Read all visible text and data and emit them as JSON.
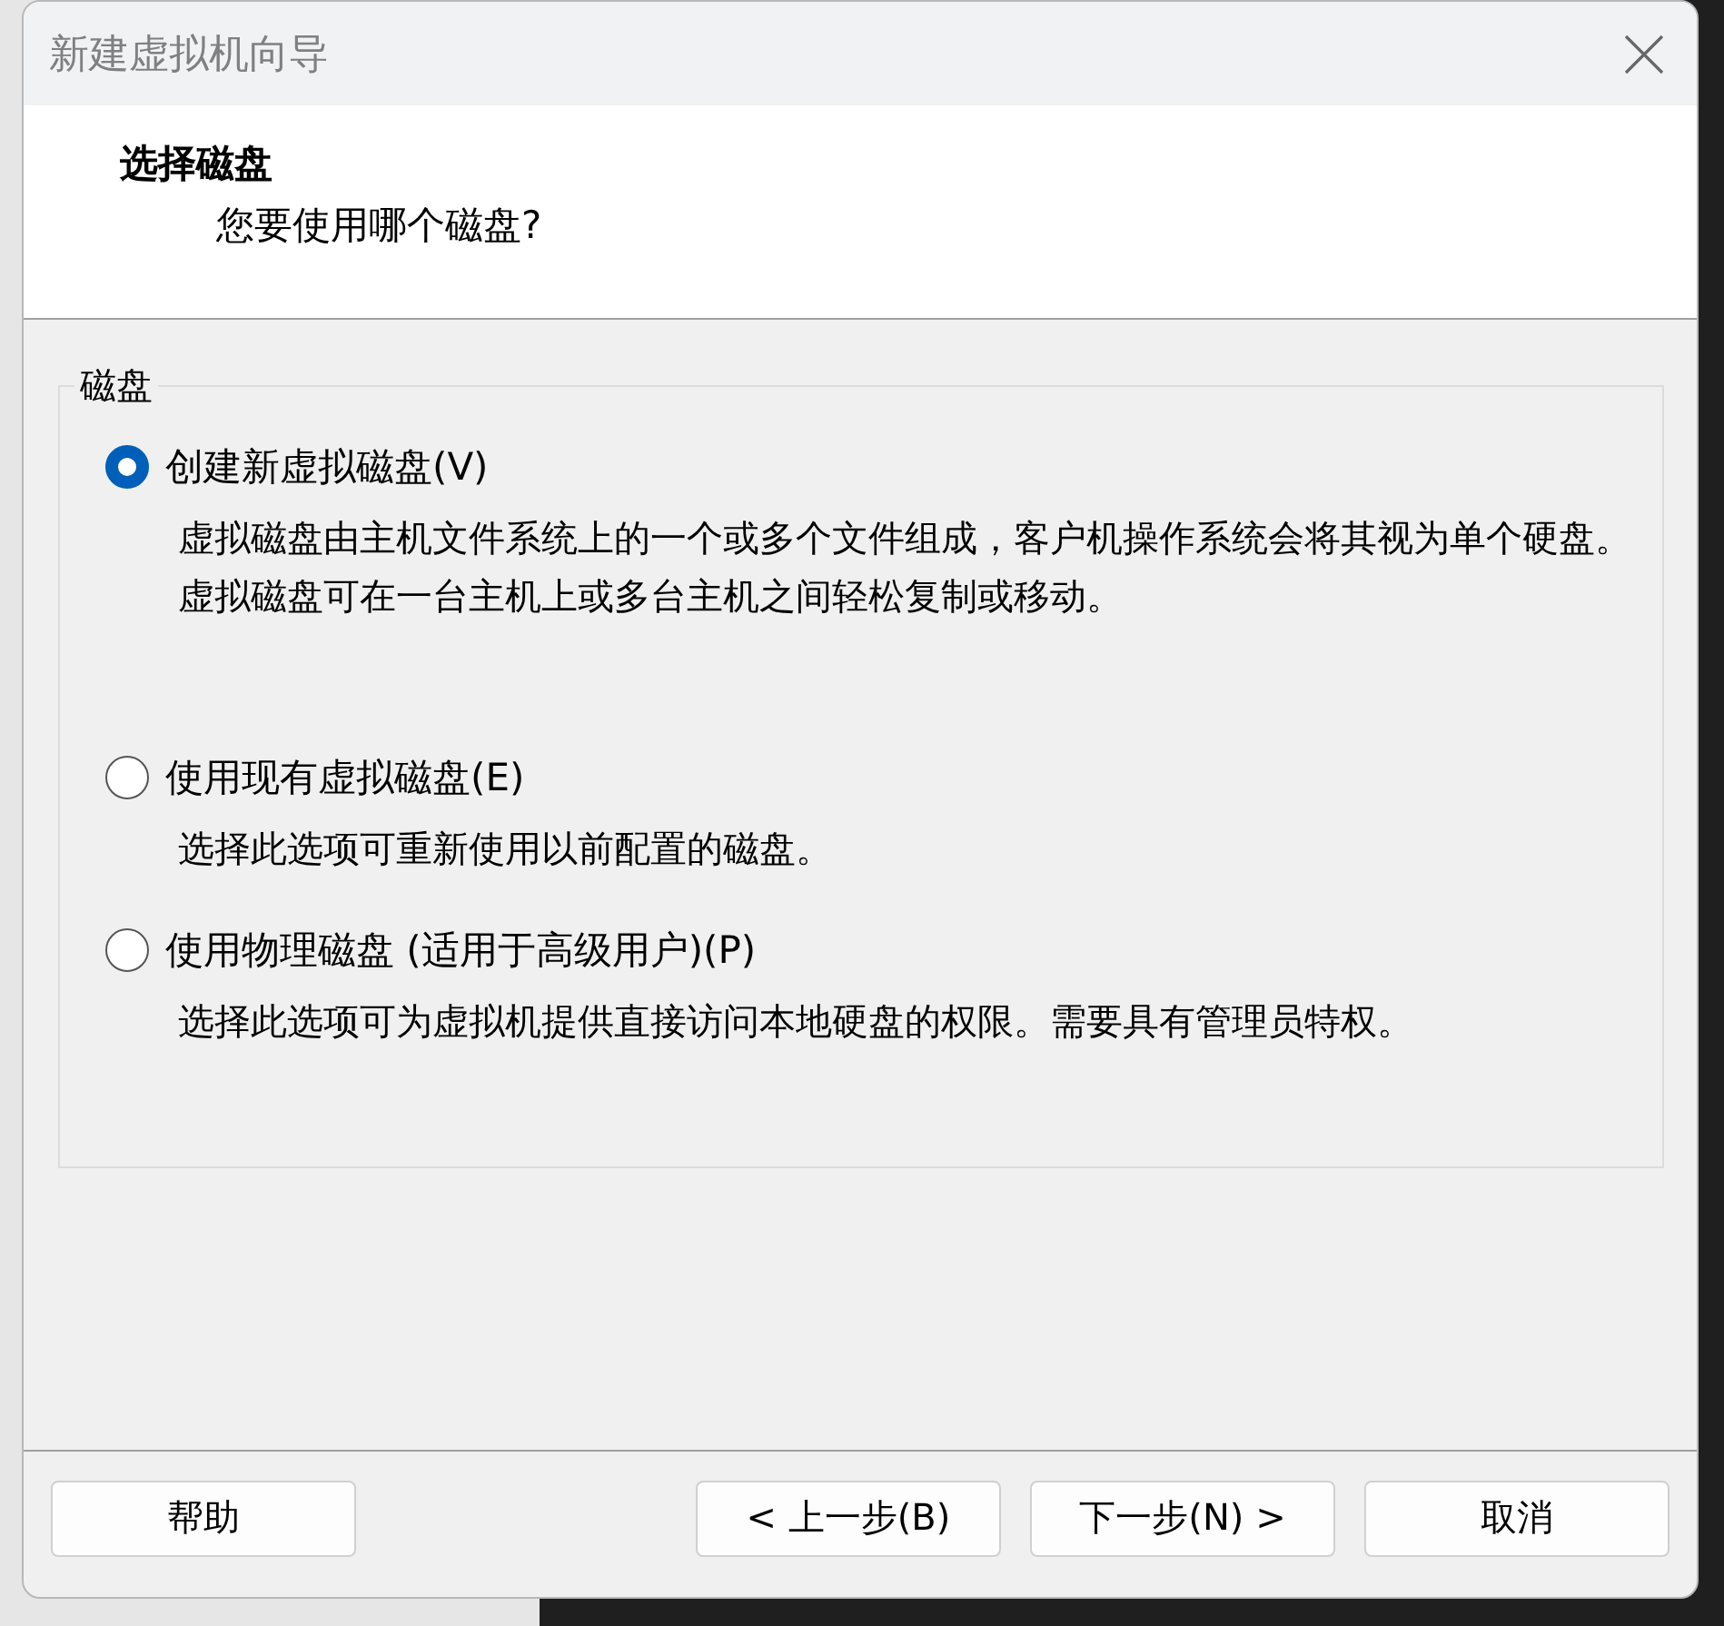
{
  "window": {
    "title": "新建虚拟机向导"
  },
  "header": {
    "title": "选择磁盘",
    "subtitle": "您要使用哪个磁盘?"
  },
  "group": {
    "legend": "磁盘",
    "options": [
      {
        "label": "创建新虚拟磁盘(V)",
        "selected": true,
        "description": "虚拟磁盘由主机文件系统上的一个或多个文件组成，客户机操作系统会将其视为单个硬盘。虚拟磁盘可在一台主机上或多台主机之间轻松复制或移动。"
      },
      {
        "label": "使用现有虚拟磁盘(E)",
        "selected": false,
        "description": "选择此选项可重新使用以前配置的磁盘。"
      },
      {
        "label": "使用物理磁盘 (适用于高级用户)(P)",
        "selected": false,
        "description": "选择此选项可为虚拟机提供直接访问本地硬盘的权限。需要具有管理员特权。"
      }
    ]
  },
  "buttons": {
    "help": "帮助",
    "back": "< 上一步(B)",
    "next": "下一步(N) >",
    "cancel": "取消"
  }
}
